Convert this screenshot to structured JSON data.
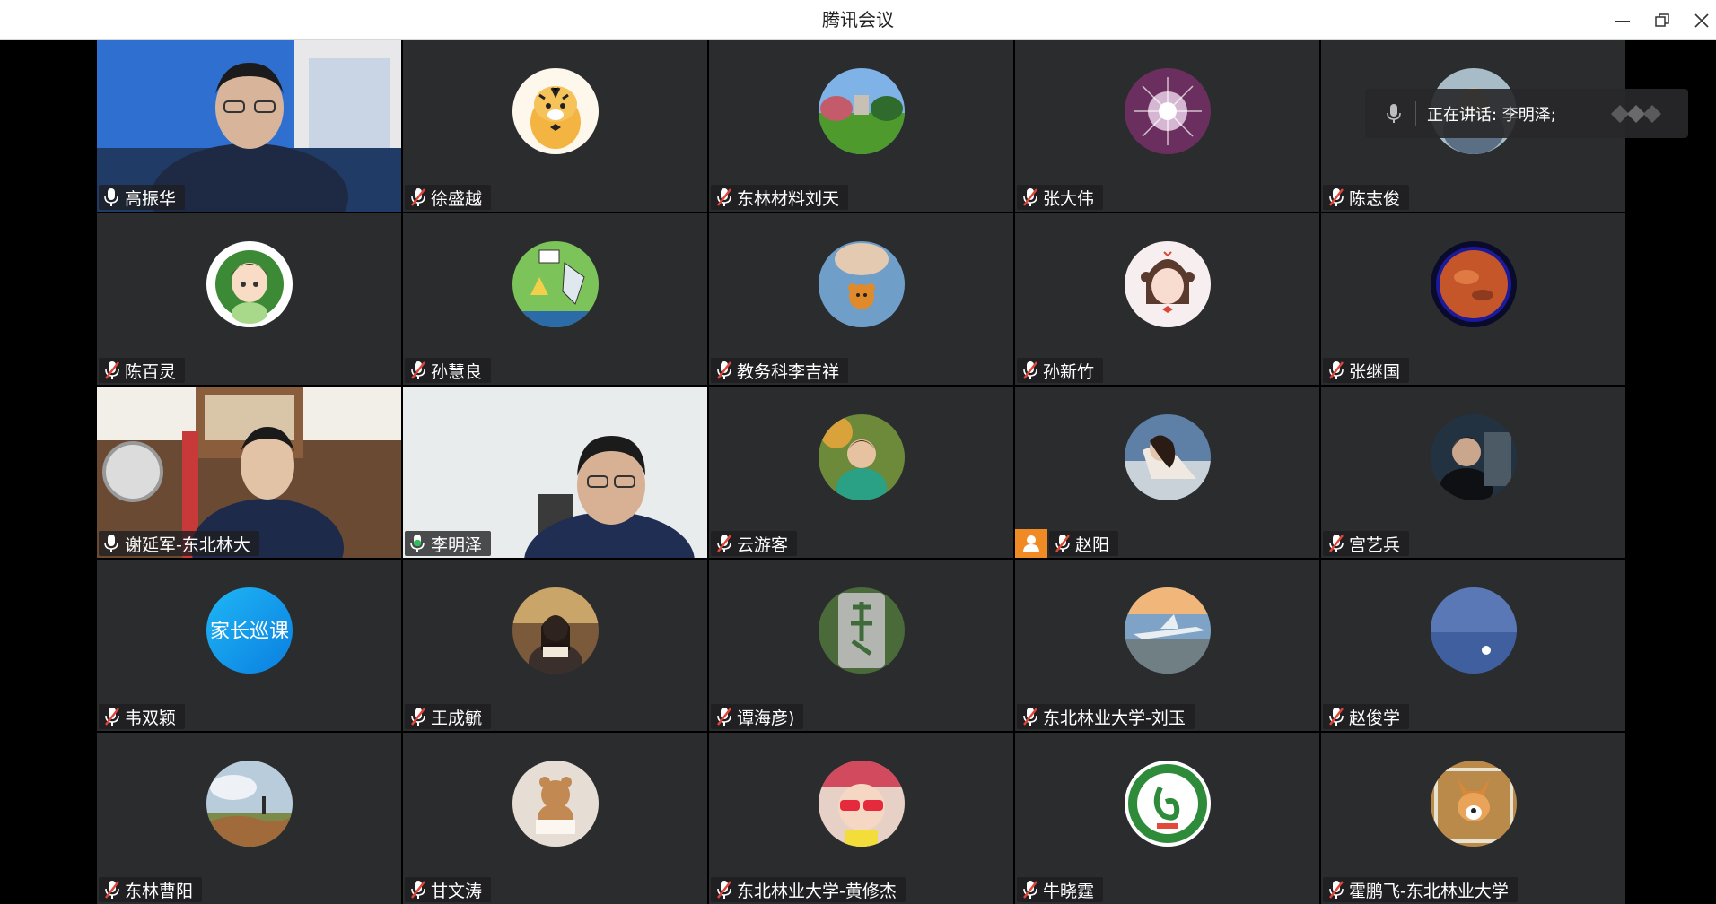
{
  "window": {
    "title": "腾讯会议",
    "minimize_icon": "minimize-icon",
    "restore_icon": "restore-icon",
    "close_icon": "close-icon"
  },
  "speaking_banner": {
    "text": "正在讲话: 李明泽;",
    "icon": "microphone-icon"
  },
  "participants": [
    {
      "name": "高振华",
      "mic": "on"
    },
    {
      "name": "徐盛越",
      "mic": "muted"
    },
    {
      "name": "东林材料刘天",
      "mic": "muted"
    },
    {
      "name": "张大伟",
      "mic": "muted"
    },
    {
      "name": "陈志俊",
      "mic": "muted"
    },
    {
      "name": "陈百灵",
      "mic": "muted"
    },
    {
      "name": "孙慧良",
      "mic": "muted"
    },
    {
      "name": "教务科李吉祥",
      "mic": "muted"
    },
    {
      "name": "孙新竹",
      "mic": "muted"
    },
    {
      "name": "张继国",
      "mic": "muted"
    },
    {
      "name": "谢延军-东北林大",
      "mic": "on"
    },
    {
      "name": "李明泽",
      "mic": "speaking"
    },
    {
      "name": "云游客",
      "mic": "muted"
    },
    {
      "name": "赵阳",
      "mic": "muted"
    },
    {
      "name": "宫艺兵",
      "mic": "muted"
    },
    {
      "name": "韦双颖",
      "mic": "muted"
    },
    {
      "name": "王成毓",
      "mic": "muted"
    },
    {
      "name": "谭海彦)",
      "mic": "muted"
    },
    {
      "name": "东北林业大学-刘玉",
      "mic": "muted"
    },
    {
      "name": "赵俊学",
      "mic": "muted"
    },
    {
      "name": "东林曹阳",
      "mic": "muted"
    },
    {
      "name": "甘文涛",
      "mic": "muted"
    },
    {
      "name": "东北林业大学-黄修杰",
      "mic": "muted"
    },
    {
      "name": "牛晓霆",
      "mic": "muted"
    },
    {
      "name": "霍鹏飞-东北林业大学",
      "mic": "muted"
    }
  ],
  "avatar_labels": {
    "wei_shuangying": "家长巡课"
  },
  "colors": {
    "tile_bg": "#2b2c2e",
    "speaking_border": "#2fc25b",
    "user_badge": "#f08a24",
    "muted_slash": "#e0453a"
  }
}
